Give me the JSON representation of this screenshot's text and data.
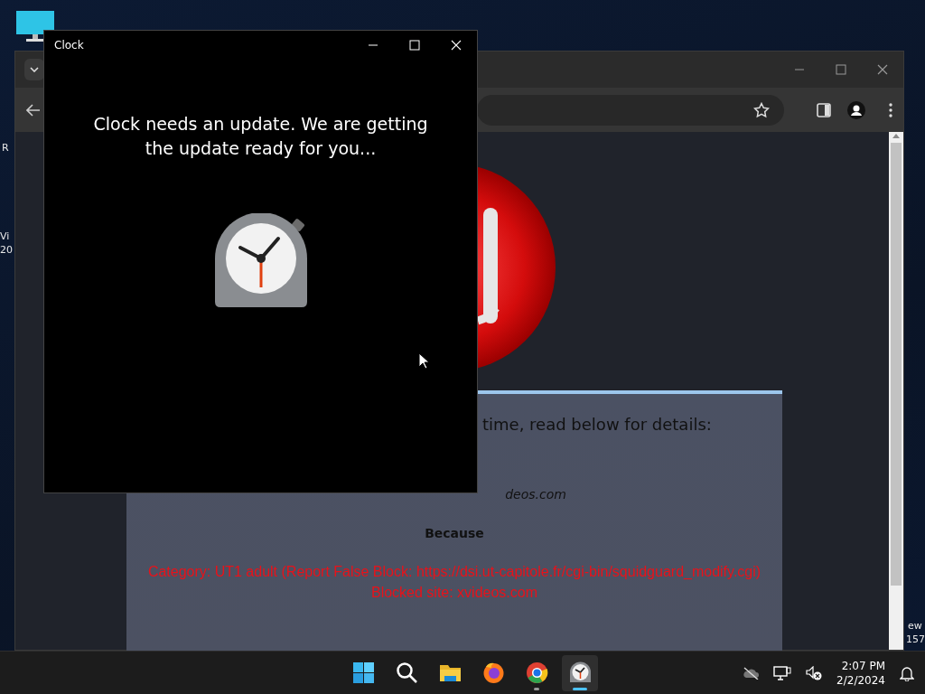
{
  "desktop": {
    "labels": [
      "R",
      "Vi",
      "20",
      "ew",
      "157"
    ]
  },
  "browser": {
    "page": {
      "heading": "time, read below for details:",
      "url": "deos.com",
      "because": "Because",
      "reason": "Category: UT1 adult (Report False Block: https://dsi.ut-capitole.fr/cgi-bin/squidguard_modify.cgi)",
      "blocked": "Blocked site: xvideos.com"
    }
  },
  "clock_window": {
    "title": "Clock",
    "message": "Clock needs an update. We are getting the update ready for you..."
  },
  "taskbar": {
    "apps": [
      {
        "kind": "start",
        "open": false,
        "active": false
      },
      {
        "kind": "search",
        "open": false,
        "active": false
      },
      {
        "kind": "files",
        "open": false,
        "active": false
      },
      {
        "kind": "firefox",
        "open": false,
        "active": false
      },
      {
        "kind": "chrome",
        "open": true,
        "active": false
      },
      {
        "kind": "clock",
        "open": true,
        "active": true
      }
    ],
    "time": "2:07 PM",
    "date": "2/2/2024"
  }
}
